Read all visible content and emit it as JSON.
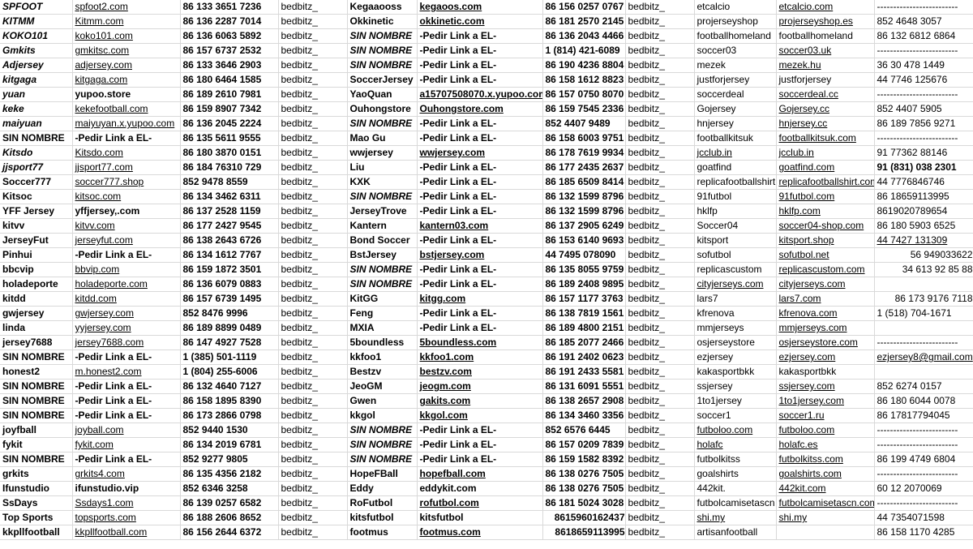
{
  "sheet": {
    "rows": [
      [
        "SPFOOT",
        "spfoot2.com",
        "86 133 3651 7236",
        "bedbitz_",
        "Kegaaooss",
        "kegaoos.com",
        "86 156 0257 0767",
        "bedbitz_",
        "etcalcio",
        "etcalcio.com",
        "-------------------------"
      ],
      [
        "KITMM",
        "Kitmm.com",
        "86 136 2287 7014",
        "bedbitz_",
        "Okkinetic",
        "okkinetic.com",
        "86 181 2570 2145",
        "bedbitz_",
        "projerseyshop",
        "projerseyshop.es",
        "852 4648 3057"
      ],
      [
        "KOKO101",
        "koko101.com",
        "86 136 6063 5892",
        "bedbitz_",
        "SIN NOMBRE",
        "-Pedir Link a EL-",
        "86 136 2043 4466",
        "bedbitz_",
        "footballhomeland",
        "footballhomeland",
        "86 132 6812 6864"
      ],
      [
        "Gmkits",
        "gmkitsc.com",
        "86 157 6737 2532",
        "bedbitz_",
        "SIN NOMBRE",
        "-Pedir Link a EL-",
        "1 (814) 421-6089",
        "bedbitz_",
        "soccer03",
        "soccer03.uk",
        "-------------------------"
      ],
      [
        "Adjersey",
        "adjersey.com",
        "86 133 3646 2903",
        "bedbitz_",
        "SIN NOMBRE",
        "-Pedir Link a EL-",
        "86 190 4236 8804",
        "bedbitz_",
        "mezek",
        "mezek.hu",
        "36 30 478 1449"
      ],
      [
        "kitgaga",
        "kitgaga.com",
        "86 180 6464 1585",
        "bedbitz_",
        "SoccerJersey",
        "-Pedir Link a EL-",
        "86 158 1612 8823",
        "bedbitz_",
        "justforjersey",
        "justforjersey",
        "44 7746 125676"
      ],
      [
        "yuan",
        "yupoo.store",
        "86 189 2610 7981",
        "bedbitz_",
        "YaoQuan",
        "a15707508070.x.yupoo.com",
        "86 157 0750 8070",
        "bedbitz_",
        "soccerdeal",
        "soccerdeal.cc",
        "-------------------------"
      ],
      [
        "keke",
        "kekefootball.com",
        "86 159 8907 7342",
        "bedbitz_",
        "Ouhongstore",
        "Ouhongstore.com",
        "86 159 7545 2336",
        "bedbitz_",
        "Gojersey",
        "Gojersey.cc",
        "852 4407 5905"
      ],
      [
        "maiyuan",
        "maiyuyan.x.yupoo.com",
        "86 136 2045 2224",
        "bedbitz_",
        "SIN NOMBRE",
        "-Pedir Link a EL-",
        "852 4407 9489",
        "bedbitz_",
        "hnjersey",
        "hnjersey.cc",
        "86 189 7856 9271"
      ],
      [
        "SIN NOMBRE",
        "-Pedir Link a EL-",
        "86 135 5611 9555",
        "bedbitz_",
        "Mao Gu",
        "-Pedir Link a EL-",
        "86 158 6003 9751",
        "bedbitz_",
        "footballkitsuk",
        "footballkitsuk.com",
        "-------------------------"
      ],
      [
        "Kitsdo",
        "Kitsdo.com",
        "86 180 3870 0151",
        "bedbitz_",
        "wwjersey",
        "wwjersey.com",
        "86 178 7619 9934",
        "bedbitz_",
        "jcclub.in",
        "jcclub.in",
        "91 77362 88146"
      ],
      [
        "jjsport77",
        "jjsport77.com",
        "86 184 76310 729",
        "bedbitz_",
        "Liu",
        "-Pedir Link a EL-",
        "86 177 2435 2637",
        "bedbitz_",
        "goatfind",
        "goatfind.com",
        "91 (831) 038 2301"
      ],
      [
        "Soccer777",
        "soccer777.shop",
        "852 9478 8559",
        "bedbitz_",
        "KXK",
        "-Pedir Link a EL-",
        "86 185 6509 8414",
        "bedbitz_",
        "replicafootballshirt",
        "replicafootballshirt.com",
        "44 7776846746"
      ],
      [
        "Kitsoc",
        "kitsoc.com",
        "86 134 3462 6311",
        "bedbitz_",
        "SIN NOMBRE",
        "-Pedir Link a EL-",
        "86 132 1599 8796",
        "bedbitz_",
        "91futbol",
        "91futbol.com",
        "86 18659113995"
      ],
      [
        "YFF Jersey",
        "yffjersey,.com",
        "86 137 2528 1159",
        "bedbitz_",
        "JerseyTrove",
        "-Pedir Link a EL-",
        "86 132 1599 8796",
        "bedbitz_",
        "hklfp",
        "hklfp.com",
        "8619020789654"
      ],
      [
        "kitvv",
        "kitvv.com",
        "86 177 2427 9545",
        "bedbitz_",
        "Kantern",
        "kantern03.com",
        "86 137 2905 6249",
        "bedbitz_",
        "Soccer04",
        "soccer04-shop.com",
        "86 180 5903 6525"
      ],
      [
        "JerseyFut",
        "jerseyfut.com",
        "86 138 2643 6726",
        "bedbitz_",
        "Bond Soccer",
        "-Pedir Link a EL-",
        "86 153 6140 9693",
        "bedbitz_",
        "kitsport",
        "kitsport.shop",
        "44 7427 131309"
      ],
      [
        "Pinhui",
        "-Pedir Link a EL-",
        "86 134 1612 7767",
        "bedbitz_",
        "BstJersey",
        "bstjersey.com",
        "44 7495 078090",
        "bedbitz_",
        "sofutbol",
        "sofutbol.net",
        "56 949033622"
      ],
      [
        "bbcvip",
        "bbvip.com",
        "86 159 1872 3501",
        "bedbitz_",
        "SIN NOMBRE",
        "-Pedir Link a EL-",
        "86 135 8055 9759",
        "bedbitz_",
        "replicascustom",
        "replicascustom.com",
        "34 613 92 85 88"
      ],
      [
        "holadeporte",
        "holadeporte.com",
        "86 136 6079 0883",
        "bedbitz_",
        "SIN NOMBRE",
        "-Pedir Link a EL-",
        "86 189 2408 9895",
        "bedbitz_",
        "cityjerseys.com",
        "cityjerseys.com",
        ""
      ],
      [
        "kitdd",
        "kitdd.com",
        "86 157 6739 1495",
        "bedbitz_",
        "KitGG",
        "kitgg.com",
        "86 157 1177 3763",
        "bedbitz_",
        "lars7",
        "lars7.com",
        "86 173 9176 7118"
      ],
      [
        "gwjersey",
        "gwjersey.com",
        "852 8476 9996",
        "bedbitz_",
        "Feng",
        "-Pedir Link a EL-",
        "86 138 7819 1561",
        "bedbitz_",
        "kfrenova",
        "kfrenova.com",
        "1 (518) 704-1671"
      ],
      [
        "linda",
        "yyjersey.com",
        "86 189 8899 0489",
        "bedbitz_",
        "MXIA",
        "-Pedir Link a EL-",
        "86 189 4800 2151",
        "bedbitz_",
        "mmjerseys",
        "mmjerseys.com",
        ""
      ],
      [
        "jersey7688",
        "jersey7688.com",
        "86 147 4927 7528",
        "bedbitz_",
        "5boundless",
        "5boundless.com",
        "86 185 2077 2466",
        "bedbitz_",
        "osjerseystore",
        "osjerseystore.com",
        "-------------------------"
      ],
      [
        "SIN NOMBRE",
        "-Pedir Link a EL-",
        "1 (385) 501-1119",
        "bedbitz_",
        "kkfoo1",
        "kkfoo1.com",
        "86 191 2402 0623",
        "bedbitz_",
        "ezjersey",
        "ezjersey.com",
        "ezjersey8@gmail.com"
      ],
      [
        "honest2",
        "m.honest2.com",
        "1 (804) 255-6006",
        "bedbitz_",
        "Bestzv",
        "bestzv.com",
        "86 191 2433 5581",
        "bedbitz_",
        "kakasportbkk",
        "kakasportbkk",
        ""
      ],
      [
        "SIN NOMBRE",
        "-Pedir Link a EL-",
        "86 132 4640 7127",
        "bedbitz_",
        "JeoGM",
        "jeogm.com",
        "86 131 6091 5551",
        "bedbitz_",
        "ssjersey",
        "ssjersey.com",
        "852 6274 0157"
      ],
      [
        "SIN NOMBRE",
        "-Pedir Link a EL-",
        "86 158 1895 8390",
        "bedbitz_",
        "Gwen",
        "gakits.com",
        "86 138 2657 2908",
        "bedbitz_",
        "1to1jersey",
        "1to1jersey.com",
        "86 180 6044 0078"
      ],
      [
        "SIN NOMBRE",
        "-Pedir Link a EL-",
        "86 173 2866 0798",
        "bedbitz_",
        "kkgol",
        "kkgol.com",
        "86 134 3460 3356",
        "bedbitz_",
        "soccer1",
        "soccer1.ru",
        "86 17817794045"
      ],
      [
        "joyfball",
        "joyball.com",
        "852 9440 1530",
        "bedbitz_",
        "SIN NOMBRE",
        "-Pedir Link a EL-",
        "852 6576 6445",
        "bedbitz_",
        "futboloo.com",
        "futboloo.com",
        "-------------------------"
      ],
      [
        "fykit",
        "fykit.com",
        "86 134 2019 6781",
        "bedbitz_",
        "SIN NOMBRE",
        "-Pedir Link a EL-",
        "86 157 0209 7839",
        "bedbitz_",
        "holafc",
        "holafc.es",
        "-------------------------"
      ],
      [
        "SIN NOMBRE",
        "-Pedir Link a EL-",
        "852 9277 9805",
        "bedbitz_",
        "SIN NOMBRE",
        "-Pedir Link a EL-",
        "86 159 1582 8392",
        "bedbitz_",
        "futbolkitss",
        "futbolkitss.com",
        "86 199 4749 6804"
      ],
      [
        "grkits",
        "grkits4.com",
        "86 135 4356 2182",
        "bedbitz_",
        "HopeFBall",
        "hopefball.com",
        "86 138 0276 7505",
        "bedbitz_",
        "goalshirts",
        "goalshirts.com",
        "-------------------------"
      ],
      [
        "Ifunstudio",
        "ifunstudio.vip",
        "852 6346 3258",
        "bedbitz_",
        "Eddy",
        "eddykit.com",
        "86 138 0276 7505",
        "bedbitz_",
        "442kit.",
        "442kit.com",
        "60 12 2070069"
      ],
      [
        "SsDays",
        "Ssdays1.com",
        "86 139 0257 6582",
        "bedbitz_",
        "RoFutbol",
        "rofutbol.com",
        "86 181 5024 3028",
        "bedbitz_",
        "futbolcamisetascn",
        "futbolcamisetascn.com",
        "-------------------------"
      ],
      [
        "Top Sports",
        "topsports.com",
        "86 188 2606 8652",
        "bedbitz_",
        "kitsfutbol",
        "kitsfutbol",
        "8615960162437",
        "bedbitz_",
        "shi.my",
        "shi.my",
        "44 7354071598"
      ],
      [
        "kkpllfootball",
        "kkpllfootball.com",
        "86 156 2644 6372",
        "bedbitz_",
        "footmus",
        "footmus.com",
        "8618659113995",
        "bedbitz_",
        "artisanfootball",
        "",
        "86 158 1170 4285"
      ]
    ]
  }
}
